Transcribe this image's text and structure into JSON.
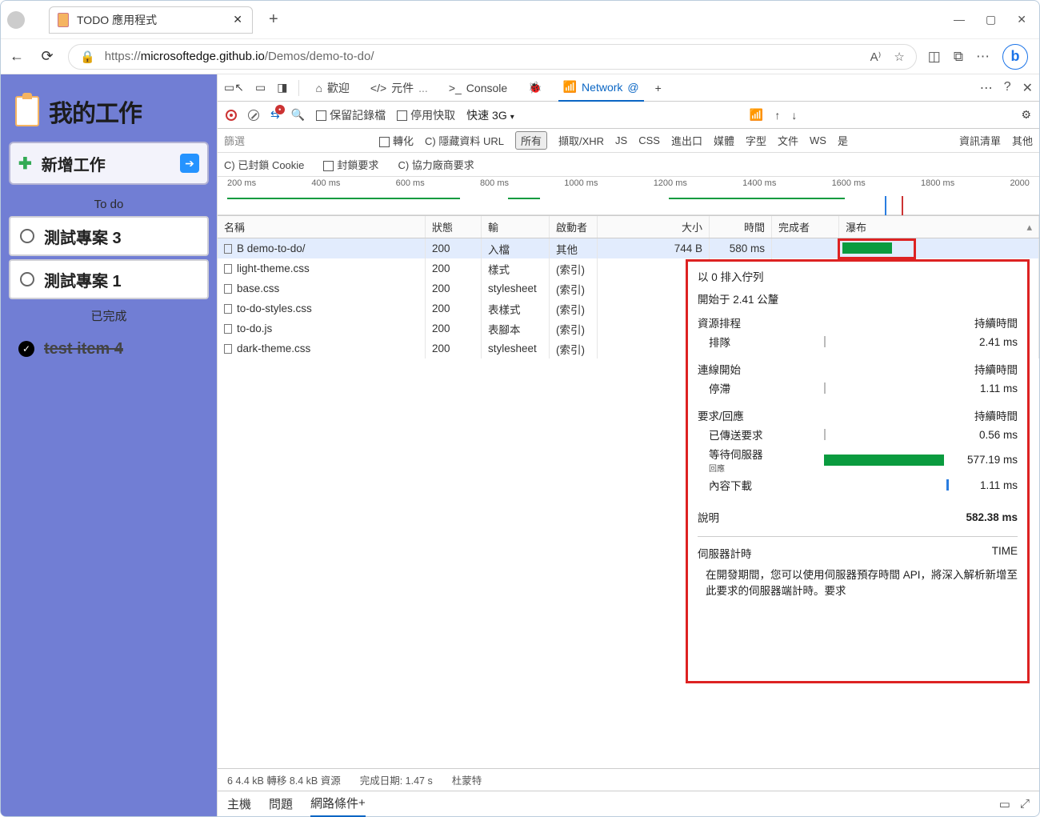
{
  "browser": {
    "tab_title": "TODO 應用程式",
    "url_protocol": "https://",
    "url_host": "microsoftedge.github.io",
    "url_path": "/Demos/demo-to-do/"
  },
  "todo_app": {
    "title": "我的工作",
    "add_label": "新增工作",
    "section_todo": "To do",
    "section_done": "已完成",
    "tasks": [
      {
        "label": "測試專案 3",
        "done": false
      },
      {
        "label": "測試專案 1",
        "done": false
      }
    ],
    "done_tasks": [
      {
        "label": "test item 4"
      }
    ]
  },
  "devtools": {
    "tabs": {
      "welcome": "歡迎",
      "elements": "元件",
      "console": "Console",
      "network": "Network"
    },
    "toolbar": {
      "preserve_log": "保留記錄檔",
      "disable_cache": "停用快取",
      "throttle": "快速 3G"
    },
    "filter_row": {
      "filter": "篩選",
      "invert": "轉化",
      "hide_data": "C) 隱藏資料 URL",
      "all": "所有",
      "fetch_xhr": "擷取/XHR",
      "js": "JS",
      "css": "CSS",
      "imgexp": "進出口",
      "media": "媒體",
      "font": "字型",
      "doc": "文件",
      "ws": "WS",
      "wasm": "是",
      "manifest": "資訊清單",
      "other": "其他"
    },
    "filter_row2": {
      "blocked_cookies": "C) 已封鎖 Cookie",
      "blocked_requests": "封鎖要求",
      "third_party": "C) 協力廠商要求"
    },
    "timeline_ticks": [
      "200 ms",
      "400 ms",
      "600 ms",
      "800 ms",
      "1000 ms",
      "1200 ms",
      "1400 ms",
      "1600 ms",
      "1800 ms",
      "2000"
    ],
    "columns": {
      "name": "名稱",
      "status": "狀態",
      "type": "輸",
      "initiator": "啟動者",
      "size": "大小",
      "time": "時間",
      "fulfilled": "完成者",
      "waterfall": "瀑布"
    },
    "rows": [
      {
        "name": "B demo-to-do/",
        "status": "200",
        "type": "入檔",
        "initiator": "其他",
        "size": "744 B",
        "time": "580 ms",
        "selected": true
      },
      {
        "name": "light-theme.css",
        "status": "200",
        "type": "樣式",
        "initiator": "(索引)"
      },
      {
        "name": "base.css",
        "status": "200",
        "type": "stylesheet",
        "initiator": "(索引)"
      },
      {
        "name": "to-do-styles.css",
        "status": "200",
        "type": "表樣式",
        "initiator": "(索引)"
      },
      {
        "name": "to-do.js",
        "status": "200",
        "type": "表腳本",
        "initiator": "(索引)"
      },
      {
        "name": "dark-theme.css",
        "status": "200",
        "type": "stylesheet",
        "initiator": "(索引)"
      }
    ],
    "status_bar": {
      "count": "6",
      "transfer": "4.4 kB 轉移 8.4 kB 資源",
      "finish": "完成日期: 1.47 s",
      "dom": "杜蒙特"
    },
    "drawer": {
      "main": "主機",
      "issues": "問題",
      "network_conditions": "網路條件"
    }
  },
  "timing": {
    "queued_title": "以 0 排入佇列",
    "started_at": "開始于 2.41 公釐",
    "section_resource": "資源排程",
    "section_conn": "連線開始",
    "section_reqresp": "要求/回應",
    "duration_label": "持續時間",
    "rows": {
      "queueing": "排隊",
      "queueing_val": "2.41 ms",
      "stalled": "停滯",
      "stalled_val": "1.11 ms",
      "request_sent": "已傳送要求",
      "request_sent_val": "0.56 ms",
      "waiting": "等待伺服器",
      "waiting_sub": "回應",
      "waiting_val": "577.19 ms",
      "download": "內容下載",
      "download_val": "1.11 ms",
      "explanation": "說明",
      "total_val": "582.38 ms"
    },
    "server_timing": "伺服器計時",
    "server_timing_right": "TIME",
    "server_timing_text": "在開發期間，您可以使用伺服器預存時間 API，將深入解析新增至此要求的伺服器端計時。要求"
  }
}
